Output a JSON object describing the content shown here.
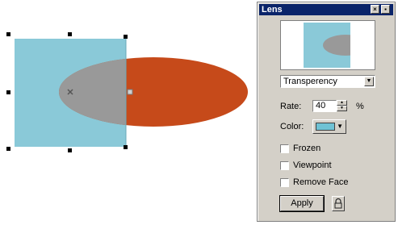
{
  "canvas": {
    "square_color": "#8ac9d8",
    "ellipse_color": "#c64a1a",
    "lens_overlap_color": "#999999"
  },
  "panel": {
    "title": "Lens",
    "title_buttons": [
      "close-icon",
      "pin-icon"
    ],
    "lens_type": "Transperency",
    "rate_label": "Rate:",
    "rate_value": "40",
    "rate_unit": "%",
    "color_label": "Color:",
    "color_value": "#6fc2d4",
    "frozen_label": "Frozen",
    "frozen_checked": false,
    "viewpoint_label": "Viewpoint",
    "viewpoint_checked": false,
    "remove_face_label": "Remove Face",
    "remove_face_checked": false,
    "apply_label": "Apply",
    "lock_icon": "lock-icon"
  }
}
